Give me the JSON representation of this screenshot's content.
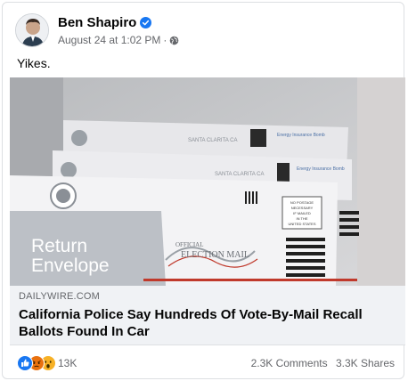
{
  "post": {
    "author": "Ben Shapiro",
    "timestamp": "August 24 at 1:02 PM",
    "separator": "·",
    "privacy_icon": "globe-icon",
    "verified_icon": "verified-badge-icon",
    "text": "Yikes."
  },
  "image": {
    "envelope_label_line1": "Return",
    "envelope_label_line2": "Envelope",
    "official_text": "OFFICIAL",
    "election_mail_text": "ELECTION MAIL",
    "postage_text": "NO POSTAGE NECESSARY IF MAILED IN THE UNITED STATES",
    "county_text": "SANTA CLARITA CA",
    "stamp_text": "Energy Insurance Bomb"
  },
  "link": {
    "domain": "DAILYWIRE.COM",
    "headline": "California Police Say Hundreds Of Vote-By-Mail Recall Ballots Found In Car"
  },
  "engagement": {
    "reaction_icons": [
      "like-icon",
      "angry-icon",
      "wow-icon"
    ],
    "reactions_count": "13K",
    "comments": "2.3K Comments",
    "shares": "3.3K Shares"
  },
  "colors": {
    "facebook_blue": "#1877f2",
    "angry_red": "#e9710f",
    "wow_yellow": "#f7b125",
    "secondary_text": "#65676b",
    "link_bg": "#f0f2f5",
    "envelope_text": "#9aa0a6"
  }
}
